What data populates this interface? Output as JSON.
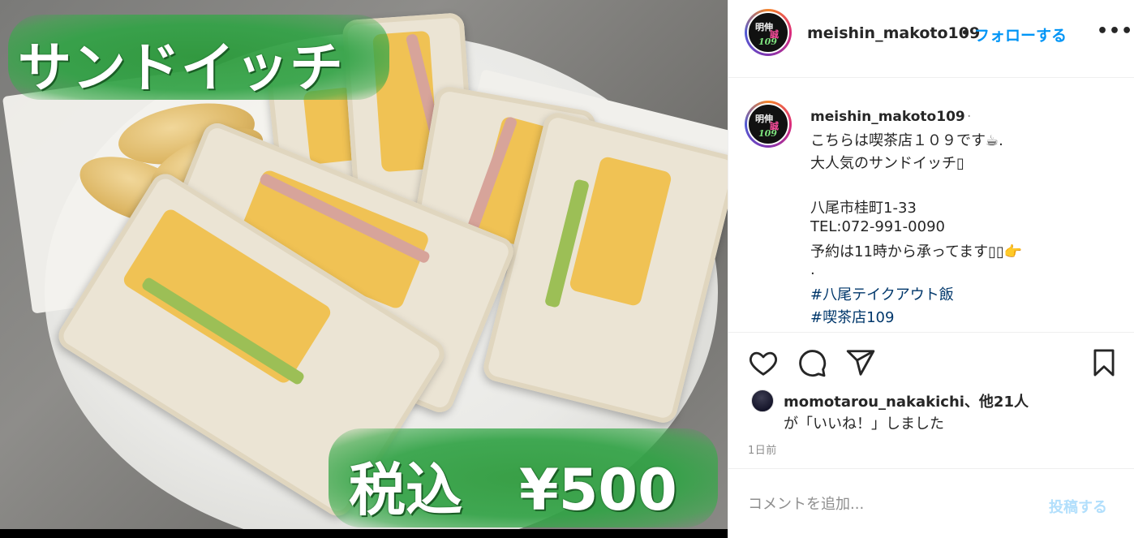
{
  "photo": {
    "title_overlay": "サンドイッチ",
    "price_overlay": "税込　¥500"
  },
  "header": {
    "username": "meishin_makoto109",
    "separator": "•",
    "follow_label": "フォローする",
    "more_label": "•••",
    "avatar_text": [
      "明伸",
      "誠",
      "109"
    ]
  },
  "caption": {
    "username": "meishin_makoto109",
    "separator": "·",
    "lines": [
      "こちらは喫茶店１０９です☕.",
      "大人気のサンドイッチ▯",
      "",
      "八尾市桂町1-33",
      "TEL:072-991-0090",
      "予約は11時から承ってます▯▯👉",
      "."
    ],
    "hashtags": [
      "#八尾テイクアウト飯",
      "#喫茶店109"
    ]
  },
  "actions": {
    "like_icon": "heart-icon",
    "comment_icon": "comment-icon",
    "share_icon": "share-icon",
    "save_icon": "bookmark-icon"
  },
  "likes": {
    "line1": "momotarou_nakakichi、他21人",
    "line2": "が「いいね！」しました"
  },
  "timestamp": "1日前",
  "comment": {
    "placeholder": "コメントを追加...",
    "post_label": "投稿する"
  },
  "colors": {
    "follow": "#0095f6",
    "hashtag": "#00376b",
    "post_disabled": "#b2dffc",
    "brush_green": "#2f9a3e"
  }
}
